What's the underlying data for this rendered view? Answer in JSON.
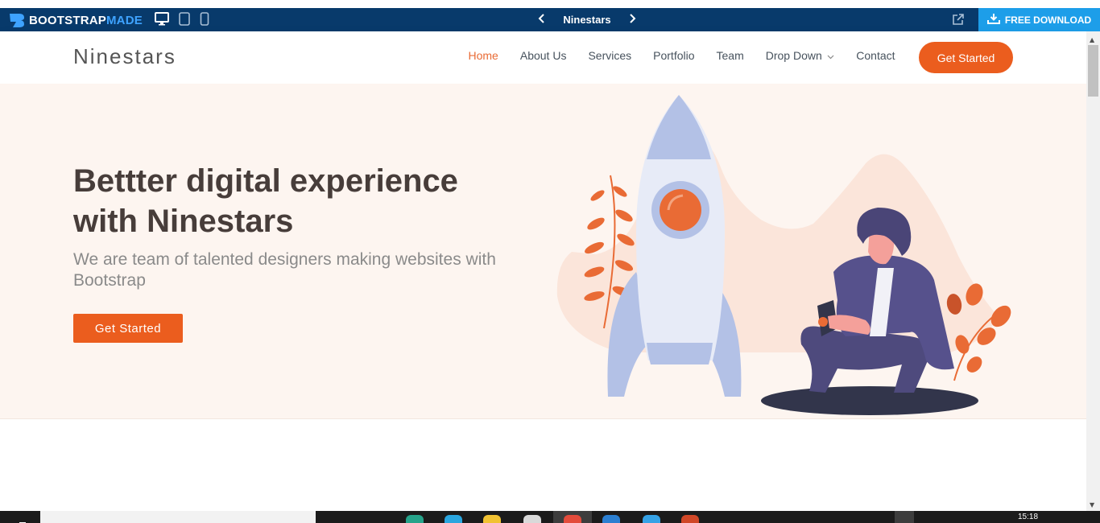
{
  "topbar": {
    "brand_main": "BOOTSTRAP",
    "brand_accent": "MADE",
    "theme_name": "Ninestars",
    "download_label": "FREE DOWNLOAD",
    "devices": [
      "desktop-icon",
      "tablet-icon",
      "mobile-icon"
    ]
  },
  "header": {
    "logo": "Ninestars",
    "nav": [
      {
        "label": "Home",
        "active": true
      },
      {
        "label": "About Us"
      },
      {
        "label": "Services"
      },
      {
        "label": "Portfolio"
      },
      {
        "label": "Team"
      },
      {
        "label": "Drop Down",
        "has_dropdown": true
      },
      {
        "label": "Contact"
      }
    ],
    "cta": "Get Started"
  },
  "hero": {
    "title_line1": "Bettter digital experience",
    "title_line2": "with Ninestars",
    "subtitle": "We are team of talented designers making websites with Bootstrap",
    "button": "Get Started"
  },
  "taskbar": {
    "clock": "15:18"
  },
  "colors": {
    "accent": "#eb5d1e",
    "topbar": "#083a6b",
    "download": "#1d9ee9",
    "hero_bg": "#fdf5f0"
  }
}
